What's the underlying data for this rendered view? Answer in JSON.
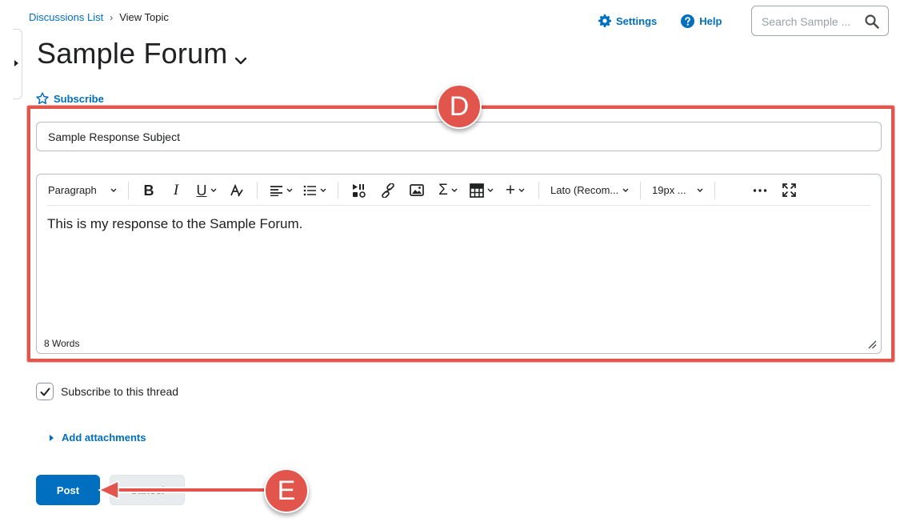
{
  "breadcrumb": {
    "parent": "Discussions List",
    "separator": "›",
    "current": "View Topic"
  },
  "header": {
    "settings_label": "Settings",
    "help_label": "Help",
    "search_placeholder": "Search Sample ..."
  },
  "topic": {
    "title": "Sample Forum",
    "subscribe_label": "Subscribe"
  },
  "reply": {
    "subject_value": "Sample Response Subject",
    "toolbar": {
      "paragraph_label": "Paragraph",
      "font_label": "Lato (Recom...",
      "size_label": "19px ..."
    },
    "body_text": "This is my response to the Sample Forum.",
    "word_count": "8 Words"
  },
  "options": {
    "subscribe_thread_label": "Subscribe to this thread",
    "subscribe_thread_checked": true,
    "add_attachments_label": "Add attachments"
  },
  "actions": {
    "post_label": "Post",
    "cancel_label": "Cancel"
  },
  "annotations": {
    "d_label": "D",
    "e_label": "E"
  },
  "colors": {
    "link": "#006fbf",
    "primary_button": "#006fbf",
    "annotation": "#e2554c"
  }
}
